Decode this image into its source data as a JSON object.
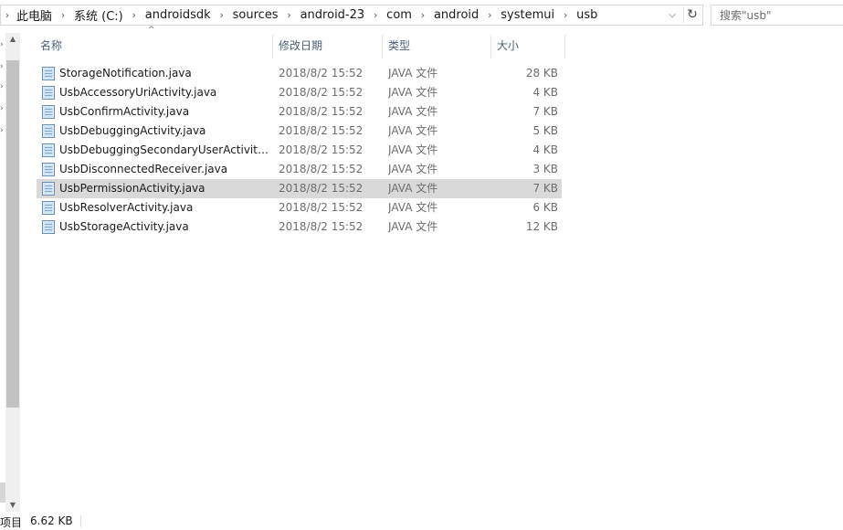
{
  "address": {
    "crumbs": [
      "此电脑",
      "系统 (C:)",
      "androidsdk",
      "sources",
      "android-23",
      "com",
      "android",
      "systemui",
      "usb"
    ],
    "separator": "›",
    "dropdown_glyph": "⌵",
    "refresh_glyph": "↻"
  },
  "search": {
    "placeholder": "搜索\"usb\"",
    "value": ""
  },
  "columns": {
    "name": "名称",
    "date": "修改日期",
    "type": "类型",
    "size": "大小"
  },
  "files": [
    {
      "name": "StorageNotification.java",
      "date": "2018/8/2 15:52",
      "type": "JAVA 文件",
      "size": "28 KB",
      "selected": false
    },
    {
      "name": "UsbAccessoryUriActivity.java",
      "date": "2018/8/2 15:52",
      "type": "JAVA 文件",
      "size": "4 KB",
      "selected": false
    },
    {
      "name": "UsbConfirmActivity.java",
      "date": "2018/8/2 15:52",
      "type": "JAVA 文件",
      "size": "7 KB",
      "selected": false
    },
    {
      "name": "UsbDebuggingActivity.java",
      "date": "2018/8/2 15:52",
      "type": "JAVA 文件",
      "size": "5 KB",
      "selected": false
    },
    {
      "name": "UsbDebuggingSecondaryUserActivity...",
      "date": "2018/8/2 15:52",
      "type": "JAVA 文件",
      "size": "4 KB",
      "selected": false
    },
    {
      "name": "UsbDisconnectedReceiver.java",
      "date": "2018/8/2 15:52",
      "type": "JAVA 文件",
      "size": "3 KB",
      "selected": false
    },
    {
      "name": "UsbPermissionActivity.java",
      "date": "2018/8/2 15:52",
      "type": "JAVA 文件",
      "size": "7 KB",
      "selected": true
    },
    {
      "name": "UsbResolverActivity.java",
      "date": "2018/8/2 15:52",
      "type": "JAVA 文件",
      "size": "6 KB",
      "selected": false
    },
    {
      "name": "UsbStorageActivity.java",
      "date": "2018/8/2 15:52",
      "type": "JAVA 文件",
      "size": "12 KB",
      "selected": false
    }
  ],
  "status": {
    "items_label": "项目",
    "selected_size": "6.62 KB"
  },
  "colors": {
    "selected_row": "#d9d9d9",
    "header_text": "#4c607a",
    "secondary_text": "#6d6d6d"
  }
}
